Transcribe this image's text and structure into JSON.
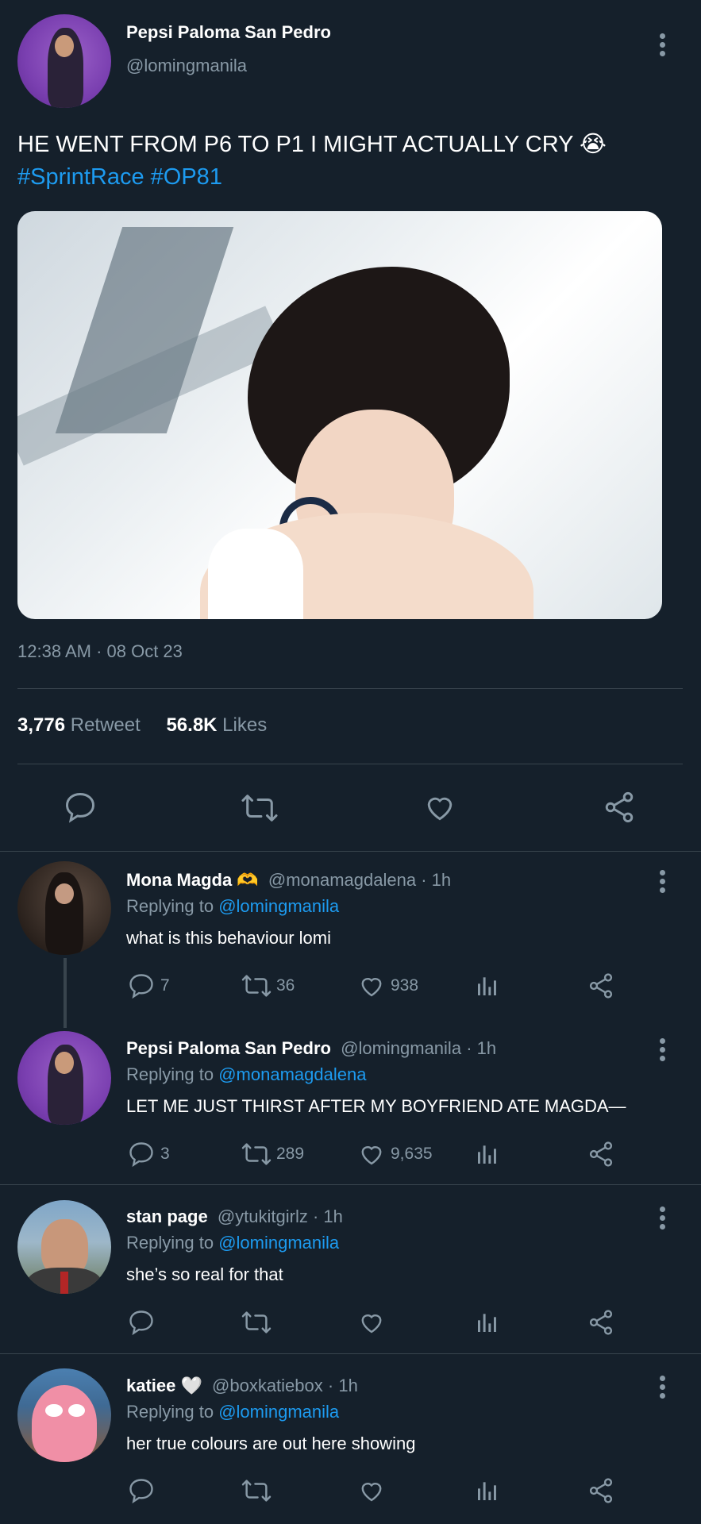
{
  "main_tweet": {
    "author_name": "Pepsi Paloma San Pedro",
    "handle": "@lomingmanila",
    "text_line1": "HE WENT FROM P6 TO P1 I MIGHT ACTUALLY CRY 😭",
    "hashtag1": "#SprintRace",
    "hashtag2": "#OP81",
    "timestamp": "12:38 AM · 08 Oct 23",
    "retweets_count": "3,776",
    "retweets_label": "Retweet",
    "likes_count": "56.8K",
    "likes_label": "Likes"
  },
  "replies": [
    {
      "author_name": "Mona Magda 🫶",
      "handle": "@monamagdalena",
      "time": "· 1h",
      "replying_label": "Replying to",
      "replying_to": "@lomingmanila",
      "text": "what is this behaviour lomi",
      "reply_count": "7",
      "retweet_count": "36",
      "like_count": "938"
    },
    {
      "author_name": "Pepsi Paloma San Pedro",
      "handle": "@lomingmanila",
      "time": "· 1h",
      "replying_label": "Replying to",
      "replying_to": "@monamagdalena",
      "text": "LET ME JUST THIRST AFTER MY BOYFRIEND ATE MAGDA—",
      "reply_count": "3",
      "retweet_count": "289",
      "like_count": "9,635"
    },
    {
      "author_name": "stan page",
      "handle": "@ytukitgirlz",
      "time": "· 1h",
      "replying_label": "Replying to",
      "replying_to": "@lomingmanila",
      "text": "she’s so real for that",
      "reply_count": "",
      "retweet_count": "",
      "like_count": ""
    },
    {
      "author_name": "katiee 🤍",
      "handle": "@boxkatiebox",
      "time": "· 1h",
      "replying_label": "Replying to",
      "replying_to": "@lomingmanila",
      "text": "her true colours are out here showing",
      "reply_count": "",
      "retweet_count": "",
      "like_count": ""
    }
  ],
  "colors": {
    "background": "#15202b",
    "link": "#1d9bf0",
    "muted": "#8899a6",
    "divider": "#38444d"
  }
}
